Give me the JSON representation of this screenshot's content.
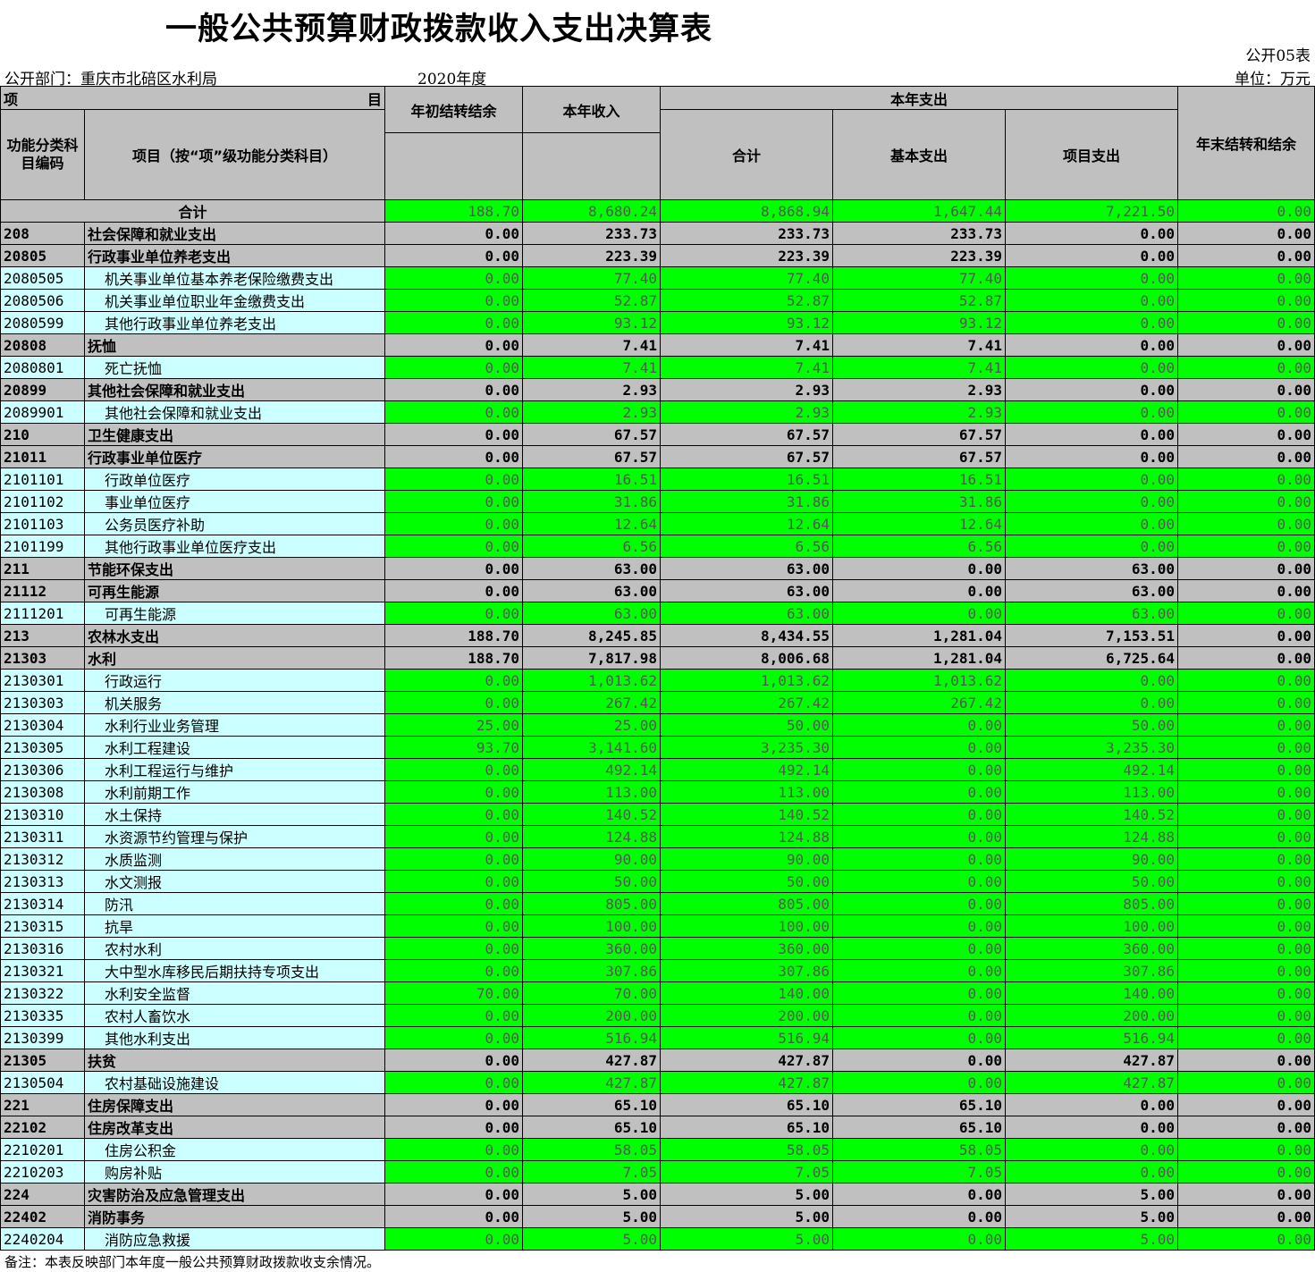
{
  "title": "一般公共预算财政拨款收入支出决算表",
  "form_code": "公开05表",
  "department": "公开部门：重庆市北碚区水利局",
  "year": "2020年度",
  "unit": "单位：万元",
  "headers": {
    "item_left": "项",
    "item_right": "目",
    "code": "功能分类科目编码",
    "name": "项目（按“项”级功能分类科目）",
    "start_balance": "年初结转结余",
    "income": "本年收入",
    "expense_group": "本年支出",
    "expense_total": "合计",
    "basic": "基本支出",
    "project": "项目支出",
    "end_balance": "年末结转和结余"
  },
  "total": {
    "label": "合计",
    "values": [
      "188.70",
      "8,680.24",
      "8,868.94",
      "1,647.44",
      "7,221.50",
      "0.00"
    ]
  },
  "rows": [
    {
      "level": 1,
      "code": "208",
      "name": "社会保障和就业支出",
      "values": [
        "0.00",
        "233.73",
        "233.73",
        "233.73",
        "0.00",
        "0.00"
      ]
    },
    {
      "level": 2,
      "code": "20805",
      "name": "行政事业单位养老支出",
      "values": [
        "0.00",
        "223.39",
        "223.39",
        "223.39",
        "0.00",
        "0.00"
      ]
    },
    {
      "level": 3,
      "code": "2080505",
      "name": "机关事业单位基本养老保险缴费支出",
      "values": [
        "0.00",
        "77.40",
        "77.40",
        "77.40",
        "0.00",
        "0.00"
      ]
    },
    {
      "level": 3,
      "code": "2080506",
      "name": "机关事业单位职业年金缴费支出",
      "values": [
        "0.00",
        "52.87",
        "52.87",
        "52.87",
        "0.00",
        "0.00"
      ]
    },
    {
      "level": 3,
      "code": "2080599",
      "name": "其他行政事业单位养老支出",
      "values": [
        "0.00",
        "93.12",
        "93.12",
        "93.12",
        "0.00",
        "0.00"
      ]
    },
    {
      "level": 2,
      "code": "20808",
      "name": "抚恤",
      "values": [
        "0.00",
        "7.41",
        "7.41",
        "7.41",
        "0.00",
        "0.00"
      ]
    },
    {
      "level": 3,
      "code": "2080801",
      "name": "死亡抚恤",
      "values": [
        "0.00",
        "7.41",
        "7.41",
        "7.41",
        "0.00",
        "0.00"
      ]
    },
    {
      "level": 2,
      "code": "20899",
      "name": "其他社会保障和就业支出",
      "values": [
        "0.00",
        "2.93",
        "2.93",
        "2.93",
        "0.00",
        "0.00"
      ]
    },
    {
      "level": 3,
      "code": "2089901",
      "name": "其他社会保障和就业支出",
      "values": [
        "0.00",
        "2.93",
        "2.93",
        "2.93",
        "0.00",
        "0.00"
      ]
    },
    {
      "level": 1,
      "code": "210",
      "name": "卫生健康支出",
      "values": [
        "0.00",
        "67.57",
        "67.57",
        "67.57",
        "0.00",
        "0.00"
      ]
    },
    {
      "level": 2,
      "code": "21011",
      "name": "行政事业单位医疗",
      "values": [
        "0.00",
        "67.57",
        "67.57",
        "67.57",
        "0.00",
        "0.00"
      ]
    },
    {
      "level": 3,
      "code": "2101101",
      "name": "行政单位医疗",
      "values": [
        "0.00",
        "16.51",
        "16.51",
        "16.51",
        "0.00",
        "0.00"
      ]
    },
    {
      "level": 3,
      "code": "2101102",
      "name": "事业单位医疗",
      "values": [
        "0.00",
        "31.86",
        "31.86",
        "31.86",
        "0.00",
        "0.00"
      ]
    },
    {
      "level": 3,
      "code": "2101103",
      "name": "公务员医疗补助",
      "values": [
        "0.00",
        "12.64",
        "12.64",
        "12.64",
        "0.00",
        "0.00"
      ]
    },
    {
      "level": 3,
      "code": "2101199",
      "name": "其他行政事业单位医疗支出",
      "values": [
        "0.00",
        "6.56",
        "6.56",
        "6.56",
        "0.00",
        "0.00"
      ]
    },
    {
      "level": 1,
      "code": "211",
      "name": "节能环保支出",
      "values": [
        "0.00",
        "63.00",
        "63.00",
        "0.00",
        "63.00",
        "0.00"
      ]
    },
    {
      "level": 2,
      "code": "21112",
      "name": "可再生能源",
      "values": [
        "0.00",
        "63.00",
        "63.00",
        "0.00",
        "63.00",
        "0.00"
      ]
    },
    {
      "level": 3,
      "code": "2111201",
      "name": "可再生能源",
      "values": [
        "0.00",
        "63.00",
        "63.00",
        "0.00",
        "63.00",
        "0.00"
      ]
    },
    {
      "level": 1,
      "code": "213",
      "name": "农林水支出",
      "values": [
        "188.70",
        "8,245.85",
        "8,434.55",
        "1,281.04",
        "7,153.51",
        "0.00"
      ]
    },
    {
      "level": 2,
      "code": "21303",
      "name": "水利",
      "values": [
        "188.70",
        "7,817.98",
        "8,006.68",
        "1,281.04",
        "6,725.64",
        "0.00"
      ]
    },
    {
      "level": 3,
      "code": "2130301",
      "name": "行政运行",
      "values": [
        "0.00",
        "1,013.62",
        "1,013.62",
        "1,013.62",
        "0.00",
        "0.00"
      ]
    },
    {
      "level": 3,
      "code": "2130303",
      "name": "机关服务",
      "values": [
        "0.00",
        "267.42",
        "267.42",
        "267.42",
        "0.00",
        "0.00"
      ]
    },
    {
      "level": 3,
      "code": "2130304",
      "name": "水利行业业务管理",
      "values": [
        "25.00",
        "25.00",
        "50.00",
        "0.00",
        "50.00",
        "0.00"
      ]
    },
    {
      "level": 3,
      "code": "2130305",
      "name": "水利工程建设",
      "values": [
        "93.70",
        "3,141.60",
        "3,235.30",
        "0.00",
        "3,235.30",
        "0.00"
      ]
    },
    {
      "level": 3,
      "code": "2130306",
      "name": "水利工程运行与维护",
      "values": [
        "0.00",
        "492.14",
        "492.14",
        "0.00",
        "492.14",
        "0.00"
      ]
    },
    {
      "level": 3,
      "code": "2130308",
      "name": "水利前期工作",
      "values": [
        "0.00",
        "113.00",
        "113.00",
        "0.00",
        "113.00",
        "0.00"
      ]
    },
    {
      "level": 3,
      "code": "2130310",
      "name": "水土保持",
      "values": [
        "0.00",
        "140.52",
        "140.52",
        "0.00",
        "140.52",
        "0.00"
      ]
    },
    {
      "level": 3,
      "code": "2130311",
      "name": "水资源节约管理与保护",
      "values": [
        "0.00",
        "124.88",
        "124.88",
        "0.00",
        "124.88",
        "0.00"
      ]
    },
    {
      "level": 3,
      "code": "2130312",
      "name": "水质监测",
      "values": [
        "0.00",
        "90.00",
        "90.00",
        "0.00",
        "90.00",
        "0.00"
      ]
    },
    {
      "level": 3,
      "code": "2130313",
      "name": "水文测报",
      "values": [
        "0.00",
        "50.00",
        "50.00",
        "0.00",
        "50.00",
        "0.00"
      ]
    },
    {
      "level": 3,
      "code": "2130314",
      "name": "防汛",
      "values": [
        "0.00",
        "805.00",
        "805.00",
        "0.00",
        "805.00",
        "0.00"
      ]
    },
    {
      "level": 3,
      "code": "2130315",
      "name": "抗旱",
      "values": [
        "0.00",
        "100.00",
        "100.00",
        "0.00",
        "100.00",
        "0.00"
      ]
    },
    {
      "level": 3,
      "code": "2130316",
      "name": "农村水利",
      "values": [
        "0.00",
        "360.00",
        "360.00",
        "0.00",
        "360.00",
        "0.00"
      ]
    },
    {
      "level": 3,
      "code": "2130321",
      "name": "大中型水库移民后期扶持专项支出",
      "values": [
        "0.00",
        "307.86",
        "307.86",
        "0.00",
        "307.86",
        "0.00"
      ]
    },
    {
      "level": 3,
      "code": "2130322",
      "name": "水利安全监督",
      "values": [
        "70.00",
        "70.00",
        "140.00",
        "0.00",
        "140.00",
        "0.00"
      ]
    },
    {
      "level": 3,
      "code": "2130335",
      "name": "农村人畜饮水",
      "values": [
        "0.00",
        "200.00",
        "200.00",
        "0.00",
        "200.00",
        "0.00"
      ]
    },
    {
      "level": 3,
      "code": "2130399",
      "name": "其他水利支出",
      "values": [
        "0.00",
        "516.94",
        "516.94",
        "0.00",
        "516.94",
        "0.00"
      ]
    },
    {
      "level": 2,
      "code": "21305",
      "name": "扶贫",
      "values": [
        "0.00",
        "427.87",
        "427.87",
        "0.00",
        "427.87",
        "0.00"
      ]
    },
    {
      "level": 3,
      "code": "2130504",
      "name": "农村基础设施建设",
      "values": [
        "0.00",
        "427.87",
        "427.87",
        "0.00",
        "427.87",
        "0.00"
      ]
    },
    {
      "level": 1,
      "code": "221",
      "name": "住房保障支出",
      "values": [
        "0.00",
        "65.10",
        "65.10",
        "65.10",
        "0.00",
        "0.00"
      ]
    },
    {
      "level": 2,
      "code": "22102",
      "name": "住房改革支出",
      "values": [
        "0.00",
        "65.10",
        "65.10",
        "65.10",
        "0.00",
        "0.00"
      ]
    },
    {
      "level": 3,
      "code": "2210201",
      "name": "住房公积金",
      "values": [
        "0.00",
        "58.05",
        "58.05",
        "58.05",
        "0.00",
        "0.00"
      ]
    },
    {
      "level": 3,
      "code": "2210203",
      "name": "购房补贴",
      "values": [
        "0.00",
        "7.05",
        "7.05",
        "7.05",
        "0.00",
        "0.00"
      ]
    },
    {
      "level": 1,
      "code": "224",
      "name": "灾害防治及应急管理支出",
      "values": [
        "0.00",
        "5.00",
        "5.00",
        "0.00",
        "5.00",
        "0.00"
      ]
    },
    {
      "level": 2,
      "code": "22402",
      "name": "消防事务",
      "values": [
        "0.00",
        "5.00",
        "5.00",
        "0.00",
        "5.00",
        "0.00"
      ]
    },
    {
      "level": 3,
      "code": "2240204",
      "name": "消防应急救援",
      "values": [
        "0.00",
        "5.00",
        "5.00",
        "0.00",
        "5.00",
        "0.00"
      ]
    }
  ],
  "note": "备注：本表反映部门本年度一般公共预算财政拨款收支余情况。"
}
